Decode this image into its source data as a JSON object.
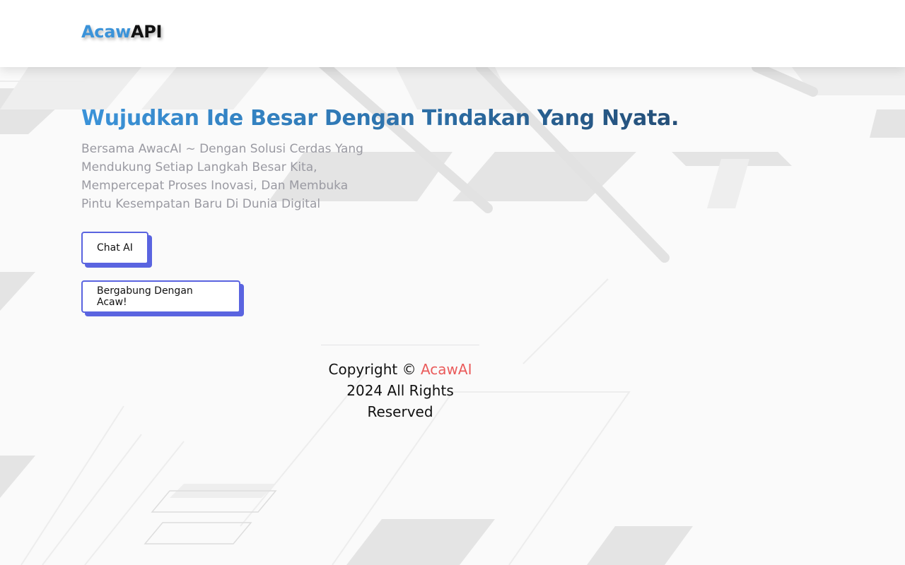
{
  "header": {
    "logo_part1": "Acaw",
    "logo_part2": "API"
  },
  "hero": {
    "title": "Wujudkan Ide Besar Dengan Tindakan Yang Nyata.",
    "description": "Bersama AwacAI ~ Dengan Solusi Cerdas Yang Mendukung Setiap Langkah Besar Kita, Mempercepat Proses Inovasi, Dan Membuka Pintu Kesempatan Baru Di Dunia Digital",
    "buttons": {
      "chat_label": "Chat AI",
      "join_label": "Bergabung Dengan Acaw!"
    }
  },
  "footer": {
    "copyright_prefix": "Copyright ©",
    "brand": "AcawAI",
    "copyright_suffix": "2024 All Rights Reserved"
  },
  "colors": {
    "logo_accent": "#3b93d9",
    "title_gradient_start": "#3b93d9",
    "title_gradient_end": "#244e77",
    "button_border": "#5a64e0",
    "footer_brand": "#ea5b5b",
    "description_text": "#9a9aa2"
  }
}
